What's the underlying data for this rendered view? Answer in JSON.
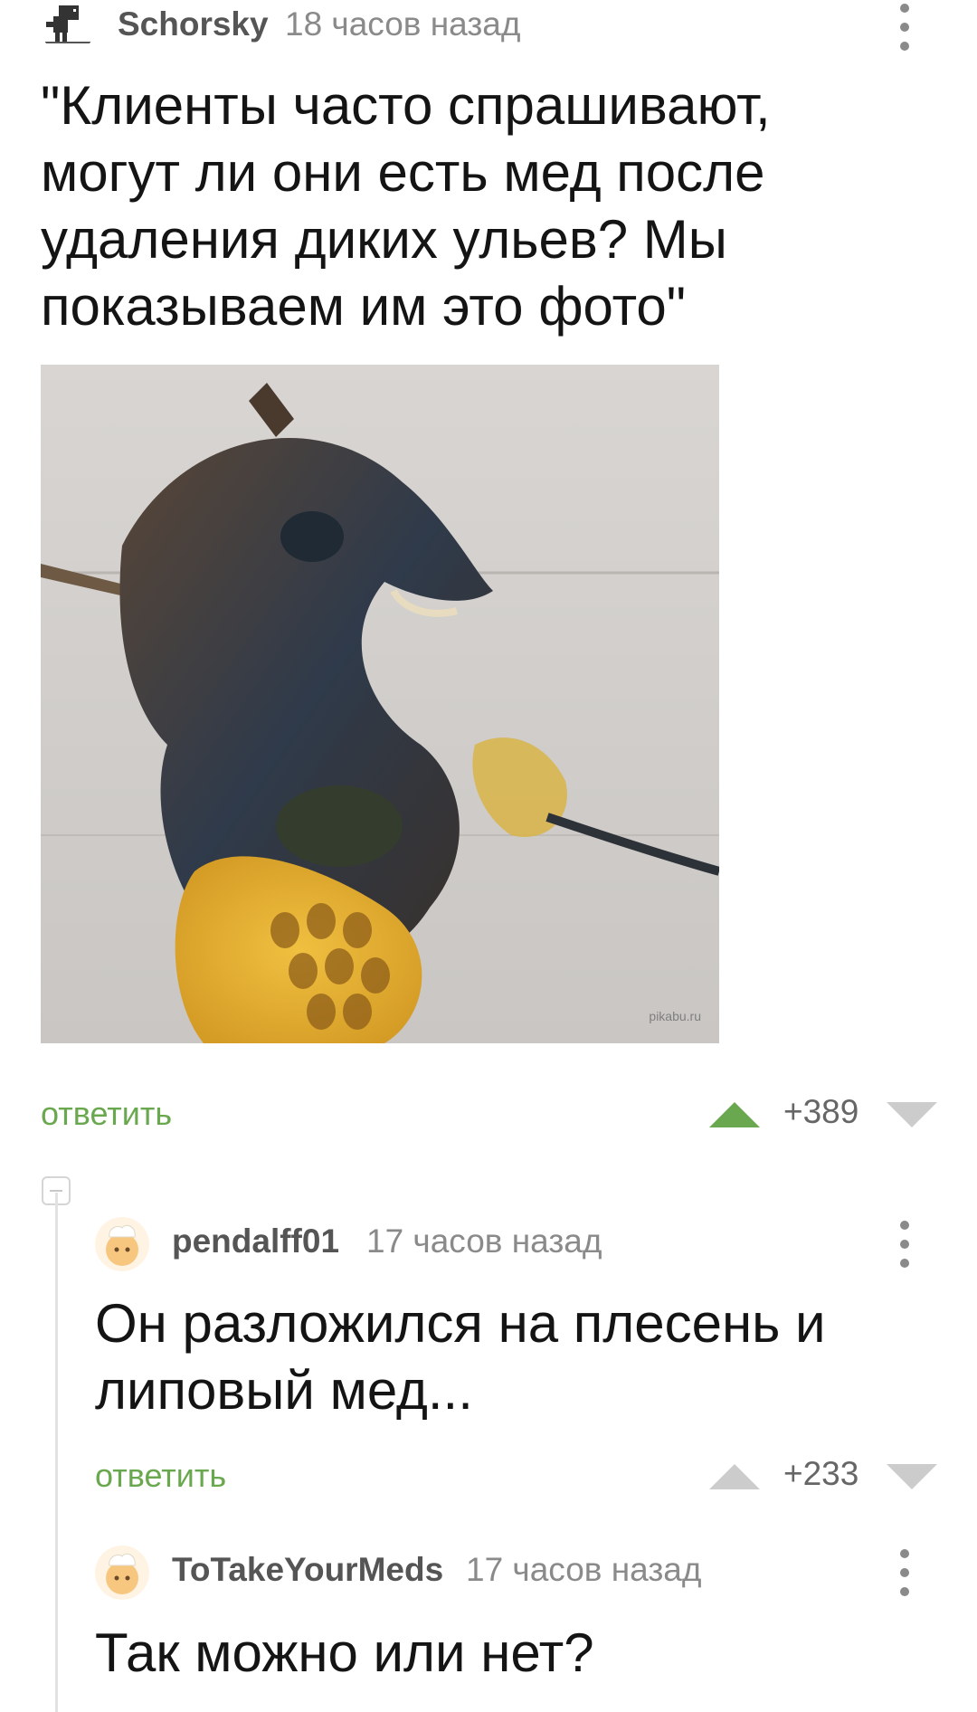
{
  "post": {
    "author": "Schorsky",
    "time": "18 часов назад",
    "text": "\"Клиенты часто спрашивают, могут ли они есть мед после удаления диких ульев? Мы показываем им это фото\"",
    "image_watermark": "pikabu.ru",
    "reply_label": "ответить",
    "score": "+389"
  },
  "comments": [
    {
      "author": "pendalff01",
      "time": "17 часов назад",
      "text": "Он разложился на плесень и липовый мед...",
      "reply_label": "ответить",
      "score": "+233"
    },
    {
      "author": "ToTakeYourMeds",
      "time": "17 часов назад",
      "text": "Так можно или нет?"
    }
  ],
  "colors": {
    "accent_green": "#6aa84f",
    "vote_inactive": "#cccccc",
    "text_gray": "#8a8a8a"
  },
  "icons": {
    "post_avatar": "dinosaur-avatar-icon",
    "comment_avatar": "chef-avatar-icon",
    "more": "more-vertical-icon",
    "upvote": "triangle-up-icon",
    "downvote": "triangle-down-icon",
    "collapse": "collapse-minus-icon"
  }
}
